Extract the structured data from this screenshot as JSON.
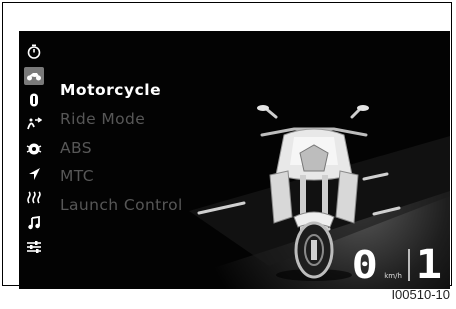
{
  "sidebar": {
    "items": [
      {
        "icon": "stopwatch-icon"
      },
      {
        "icon": "motorcycle-icon",
        "active": true
      },
      {
        "icon": "info-icon"
      },
      {
        "icon": "abs-icon"
      },
      {
        "icon": "traction-control-icon"
      },
      {
        "icon": "navigation-icon"
      },
      {
        "icon": "heated-grips-icon"
      },
      {
        "icon": "music-icon"
      },
      {
        "icon": "settings-sliders-icon"
      }
    ]
  },
  "menu": {
    "items": [
      {
        "label": "Motorcycle"
      },
      {
        "label": "Ride Mode"
      },
      {
        "label": "ABS"
      },
      {
        "label": "MTC"
      },
      {
        "label": "Launch Control"
      }
    ],
    "selected_index": 0
  },
  "status": {
    "speed": "0",
    "speed_unit": "km/h",
    "gear": "1"
  },
  "caption": "I00510-10",
  "colors": {
    "background": "#030303",
    "selected_text": "#ffffff",
    "inactive_text": "#575757"
  }
}
